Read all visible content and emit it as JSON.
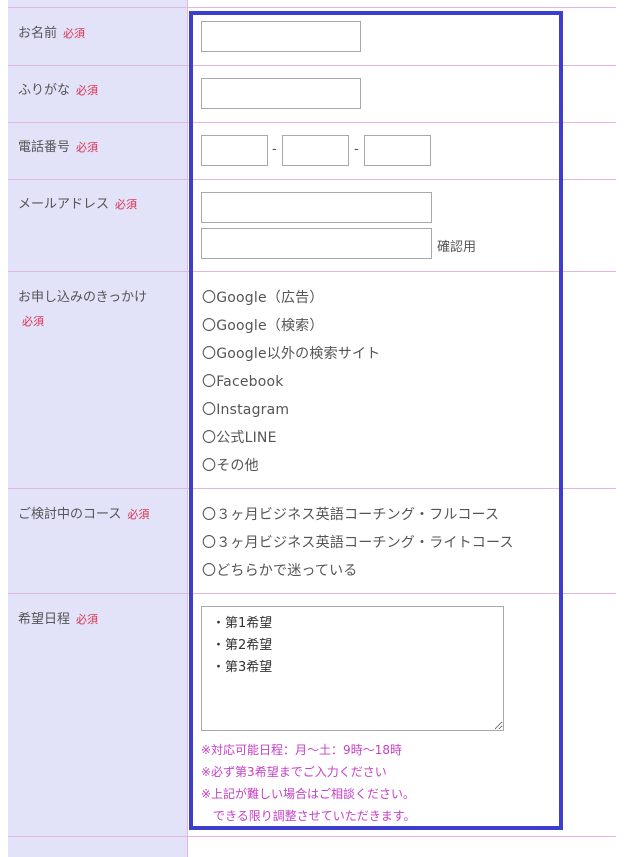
{
  "fields": {
    "name": {
      "label": "お名前",
      "required": "必須"
    },
    "furigana": {
      "label": "ふりがな",
      "required": "必須"
    },
    "phone": {
      "label": "電話番号",
      "required": "必須",
      "sep1": "-",
      "sep2": "-"
    },
    "email": {
      "label": "メールアドレス",
      "required": "必須",
      "confirm_label": "確認用"
    },
    "trigger": {
      "label": "お申し込みのきっかけ",
      "required": "必須",
      "options": [
        "〇Google（広告）",
        "〇Google（検索）",
        "〇Google以外の検索サイト",
        "〇Facebook",
        "〇Instagram",
        "〇公式LINE",
        "〇その他"
      ]
    },
    "course": {
      "label": "ご検討中のコース",
      "required": "必須",
      "options": [
        "〇３ヶ月ビジネス英語コーチング・フルコース",
        "〇３ヶ月ビジネス英語コーチング・ライトコース",
        "〇どちらかで迷っている"
      ]
    },
    "schedule": {
      "label": "希望日程",
      "required": "必須",
      "textarea_value": "・第1希望\n・第2希望\n・第3希望",
      "notes": [
        "※対応可能日程：月〜土：9時〜18時",
        "※必ず第3希望までご入力ください",
        "※上記が難しい場合はご相談ください。",
        "　できる限り調整させていただきます。"
      ]
    }
  },
  "colors": {
    "label_bg": "#e2e2f9",
    "border": "#e3b7e3",
    "required": "#d9334f",
    "note": "#c63fc6",
    "highlight": "#3d3fcc"
  }
}
